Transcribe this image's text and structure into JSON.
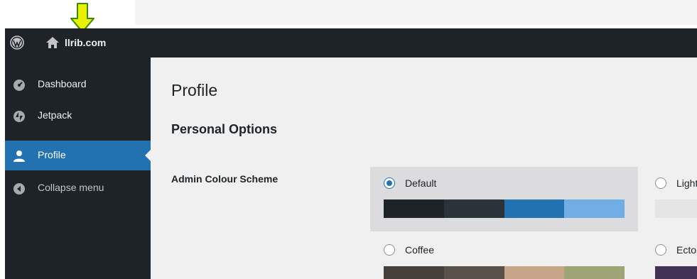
{
  "adminbar": {
    "site_name": "llrib.com",
    "wp_icon": "wordpress-icon",
    "home_icon": "home-icon"
  },
  "annotation": {
    "arrow_color": "#e8f200",
    "arrow_icon": "down-arrow-icon"
  },
  "sidebar": {
    "items": [
      {
        "label": "Dashboard",
        "icon": "dashboard-icon"
      },
      {
        "label": "Jetpack",
        "icon": "jetpack-icon"
      },
      {
        "label": "Profile",
        "icon": "user-icon",
        "active": true
      },
      {
        "label": "Collapse menu",
        "icon": "collapse-icon"
      }
    ]
  },
  "main": {
    "page_title": "Profile",
    "section_title": "Personal Options",
    "admin_colour_label": "Admin Colour Scheme",
    "schemes": [
      {
        "name": "Default",
        "checked": true,
        "colors": [
          "#1d2327",
          "#2c3338",
          "#2271b1",
          "#72aee6"
        ]
      },
      {
        "name": "Light",
        "checked": false,
        "colors": [
          "#e5e5e5",
          "#999999",
          "#d64e07",
          "#04a4cc"
        ]
      },
      {
        "name": "Coffee",
        "checked": false,
        "colors": [
          "#46403c",
          "#59524c",
          "#c7a589",
          "#9ea476"
        ]
      },
      {
        "name": "Ectoplasm",
        "checked": false,
        "colors": [
          "#413256",
          "#523f6d",
          "#a3b745",
          "#d46f15"
        ]
      }
    ]
  }
}
